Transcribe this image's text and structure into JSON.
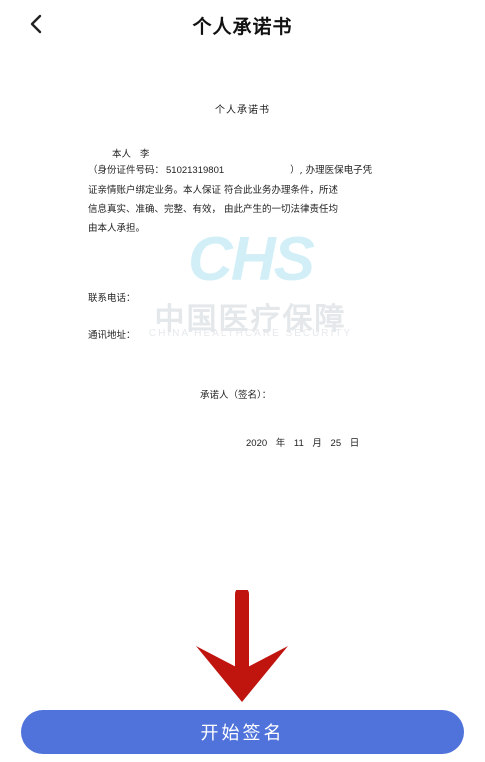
{
  "header": {
    "title": "个人承诺书",
    "back_icon": "chevron-left-icon"
  },
  "document": {
    "title": "个人承诺书",
    "self_label": "本人",
    "self_name": "李",
    "id_prefix": "（身份证件号码：",
    "id_number": "51021319801",
    "id_suffix": "）, 办理医保电子凭",
    "line2": "证亲情账户绑定业务。本人保证  符合此业务办理条件，所述",
    "line3": "信息真实、准确、完整、有效，  由此产生的一切法律责任均",
    "line4": "由本人承担。",
    "phone_label": "联系电话：",
    "address_label": "通讯地址：",
    "signer_label": "承诺人（签名）：",
    "date": "2020  年  11  月  25  日"
  },
  "watermark": {
    "logo": "CHS",
    "cn_text": "中国医疗保障",
    "en_text": "CHINA HEALTHCARE SECURITY"
  },
  "annotation": {
    "arrow_color": "#c0140f"
  },
  "action": {
    "label": "开始签名",
    "color": "#4f72db"
  }
}
